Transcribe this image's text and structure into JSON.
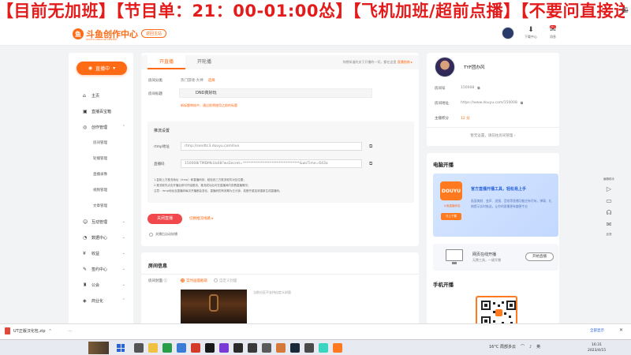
{
  "banner": {
    "text": "【目前无加班】【节目单：21：00-01:00怂】【飞机加班/超前点播】【不要问直接送"
  },
  "header": {
    "logo_text": "斗鱼创作中心",
    "logo_sub": "DOUYU CREATOR CENTER",
    "back_home": "返回主站",
    "download_label": "下载中心",
    "message_label": "消息",
    "message_badge": "99+"
  },
  "sidebar": {
    "live_button": "直播中",
    "items": [
      {
        "label": "主页",
        "icon": "home-icon"
      },
      {
        "label": "直播百宝箱",
        "icon": "toolbox-icon"
      },
      {
        "label": "创作管理",
        "icon": "create-icon",
        "expanded": true
      },
      {
        "label": "房间管理",
        "sub": true
      },
      {
        "label": "轮播管理",
        "sub": true
      },
      {
        "label": "直播录像",
        "sub": true
      },
      {
        "label": "视频管理",
        "sub": true
      },
      {
        "label": "文章管理",
        "sub": true
      },
      {
        "label": "互动管理",
        "icon": "interact-icon"
      },
      {
        "label": "数据中心",
        "icon": "data-icon"
      },
      {
        "label": "收益",
        "icon": "income-icon"
      },
      {
        "label": "签约中心",
        "icon": "sign-icon"
      },
      {
        "label": "公会",
        "icon": "guild-icon"
      },
      {
        "label": "商业化",
        "icon": "business-icon"
      }
    ]
  },
  "main": {
    "tab_live": "开直播",
    "tab_rotate": "开轮播",
    "tab_note": "你想知道的关于开播的一切，都在这里",
    "tab_note_link": "直播指南 ▸",
    "category_label": "房间分类",
    "category_value": "热门游戏-大神",
    "category_action": "选择",
    "title_label": "房间标题",
    "title_value": "DND真好玩",
    "title_warn": "新标题审核中，通过前将使用之前的标题",
    "push_title": "推流设置",
    "rtmp_label": "rtmp地址",
    "rtmp_value": "rtmp://sendtc3.douyu.com/live",
    "code_label": "直播码",
    "code_value": "150008rTMDMkUa08?wsSecret=********************************&wsTime=643a",
    "help_lines": [
      "1.复制上方推流地址（rtmp）和直播码到，粘贴到三方推流软件对应位置；",
      "2.推流软件点击开播后即可开始推流，推流成功后可在直播间内查看直播情况；",
      "注意：rtmp地址及直播码每次开播都会变化，直播码的有效期为五分钟，若断开重连请重新生成直播码。"
    ],
    "close_button": "关闭直播",
    "switch_link": "切换推流线路 ▸",
    "auto_rotate": "关播后自动轮播"
  },
  "room": {
    "heading": "房间信息",
    "cover_label": "房间封面",
    "cover_opt1": "实时画面截取",
    "cover_opt2": "自定义封面",
    "cover_note": "当前分区不支持自定义封面"
  },
  "profile": {
    "name": "TYF团办风",
    "room_no_label": "房间号",
    "room_no": "150008",
    "room_addr_label": "房间地址",
    "room_addr": "https://www.douyu.com/150008",
    "score_label": "主播积分",
    "score": "12 分",
    "note": "暂无设置，请前往房间管理 ›"
  },
  "pc": {
    "heading": "电脑开播",
    "logo": "DOUYU",
    "logo_sub": "斗鱼直播伴侣",
    "download": "马上下载",
    "title": "官方直播开播工具，轻松易上手",
    "desc": "画面美颜、变声、滤镜、音效等直播功能应有尽有，弹幕、礼物提示实时推送，让你的直播更有趣更专业"
  },
  "web": {
    "title": "网页在线开播",
    "sub": "无需工具，一键开播",
    "button": "开始直播"
  },
  "mobile": {
    "heading": "手机开播"
  },
  "rtools": [
    "编辑助手",
    "教程",
    "客服",
    "反馈"
  ],
  "download_bar": {
    "file": "UT正版汉化包.zip",
    "more": "…",
    "show_all": "全部显示"
  },
  "taskbar": {
    "weather": "16°C 局部多云",
    "lang": "英",
    "time": "16:31",
    "date": "2023/4/15"
  }
}
